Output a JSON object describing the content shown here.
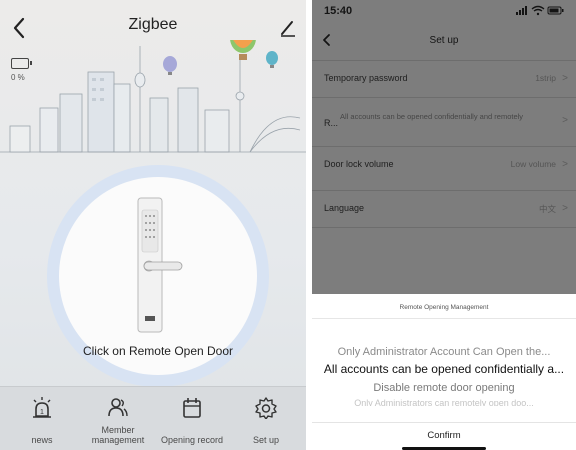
{
  "left": {
    "title": "Zigbee",
    "battery_text": "0 %",
    "open_door_text": "Click on Remote Open Door",
    "tabs": [
      {
        "label": "news",
        "icon": "alarm-icon"
      },
      {
        "label": "Member management",
        "icon": "members-icon"
      },
      {
        "label": "Opening record",
        "icon": "calendar-icon"
      },
      {
        "label": "Set up",
        "icon": "gear-icon"
      }
    ]
  },
  "right": {
    "status_time": "15:40",
    "title": "Set up",
    "rows": [
      {
        "label": "Temporary password",
        "value": "1strip"
      },
      {
        "label": "R...",
        "value": "All accounts can be opened confidentially and remotely"
      },
      {
        "label": "Door lock volume",
        "value": "Low volume"
      },
      {
        "label": "Language",
        "value": "中文"
      }
    ],
    "sheet": {
      "title": "Remote Opening Management",
      "options": [
        "Only Administrator Account Can Open the...",
        "All accounts can be opened confidentially a...",
        "Disable remote door opening",
        "Only Administrators can remotely open doo..."
      ],
      "selected_index": 1,
      "confirm_label": "Confirm"
    }
  },
  "colors": {
    "circle_ring": "#d8e3f3",
    "tabbar_bg": "#d8dbde",
    "overlay_bg": "#7d7d7d",
    "sheet_bg": "#ffffff"
  }
}
